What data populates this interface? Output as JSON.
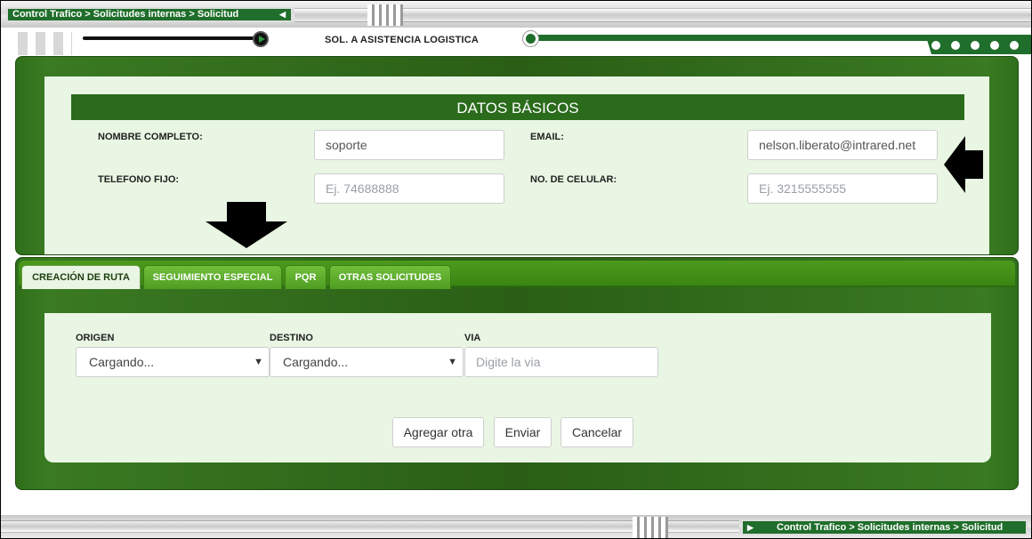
{
  "breadcrumb": "Control Trafico > Solicitudes internas > Solicitud",
  "section_title": "SOL. A ASISTENCIA LOGISTICA",
  "basics": {
    "header": "DATOS BÁSICOS",
    "fields": {
      "name_label": "NOMBRE COMPLETO:",
      "name_value": "soporte",
      "email_label": "EMAIL:",
      "email_value": "nelson.liberato@intrared.net",
      "phone_label": "TELEFONO FIJO:",
      "phone_placeholder": "Ej. 74688888",
      "mobile_label": "NO. DE CELULAR:",
      "mobile_placeholder": "Ej. 3215555555"
    }
  },
  "tabs": [
    {
      "label": "CREACIÓN DE RUTA",
      "active": true
    },
    {
      "label": "SEGUIMIENTO ESPECIAL",
      "active": false
    },
    {
      "label": "PQR",
      "active": false
    },
    {
      "label": "OTRAS SOLICITUDES",
      "active": false
    }
  ],
  "route_form": {
    "origin_label": "ORIGEN",
    "origin_value": "Cargando...",
    "destination_label": "DESTINO",
    "destination_value": "Cargando...",
    "via_label": "VIA",
    "via_placeholder": "Digite la via"
  },
  "buttons": {
    "add_label": "Agregar otra",
    "send_label": "Enviar",
    "cancel_label": "Cancelar"
  },
  "icons": {
    "play": "play-icon",
    "down_arrow": "arrow-down-icon",
    "left_arrow": "arrow-left-icon",
    "chevron": "chevron-down-icon"
  },
  "colors": {
    "brand_green": "#1f6e2b",
    "panel_green": "#2e6a1a",
    "tab_green": "#4f9d22",
    "content_bg": "#e8f6e3"
  }
}
